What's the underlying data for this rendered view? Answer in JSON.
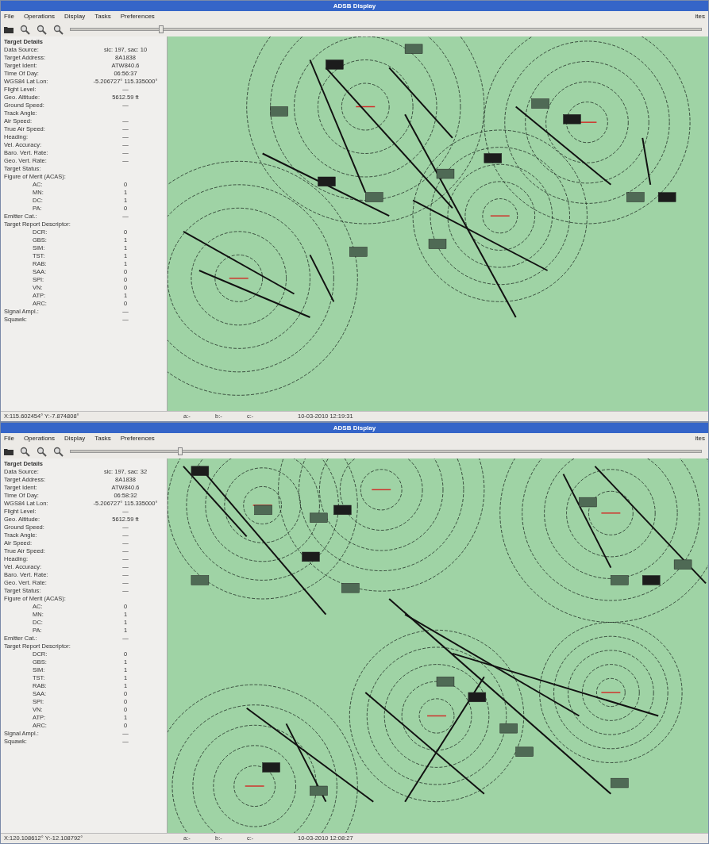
{
  "windows": [
    {
      "title": "ADSB Display",
      "menu": [
        "File",
        "Operations",
        "Display",
        "Tasks",
        "Preferences"
      ],
      "corner_label": "ites",
      "zoom_slider": {
        "level": 0.14
      },
      "panel_title": "Target Details",
      "rows": [
        {
          "kind": "field",
          "label": "Data Source:",
          "value": "sic: 197, sac: 10"
        },
        {
          "kind": "field",
          "label": "Target Address:",
          "value": "8A1838"
        },
        {
          "kind": "field",
          "label": "Target Ident:",
          "value": "ATW840.6"
        },
        {
          "kind": "field",
          "label": "Time Of Day:",
          "value": "06:56:37"
        },
        {
          "kind": "field",
          "label": "WGS84 Lat Lon:",
          "value": "-5.206727° 115.335000°"
        },
        {
          "kind": "field",
          "label": "Flight Level:",
          "value": "—"
        },
        {
          "kind": "field",
          "label": "Geo. Altitude:",
          "value": "5612.59 ft"
        },
        {
          "kind": "field",
          "label": "Ground Speed:",
          "value": "—"
        },
        {
          "kind": "field",
          "label": "Track Angle:",
          "value": ""
        },
        {
          "kind": "field",
          "label": "Air Speed:",
          "value": "—"
        },
        {
          "kind": "field",
          "label": "True Air Speed:",
          "value": "—"
        },
        {
          "kind": "field",
          "label": "Heading:",
          "value": "—"
        },
        {
          "kind": "field",
          "label": "Vel. Accuracy:",
          "value": "—"
        },
        {
          "kind": "field",
          "label": "Baro. Vert. Rate:",
          "value": "—"
        },
        {
          "kind": "field",
          "label": "Geo. Vert. Rate:",
          "value": "—"
        },
        {
          "kind": "field",
          "label": "Target Status:",
          "value": ""
        },
        {
          "kind": "field",
          "label": "Figure of Merit (ACAS):",
          "value": ""
        },
        {
          "kind": "sub",
          "label": "AC:",
          "value": "0"
        },
        {
          "kind": "sub",
          "label": "MN:",
          "value": "1"
        },
        {
          "kind": "sub",
          "label": "DC:",
          "value": "1"
        },
        {
          "kind": "sub",
          "label": "PA:",
          "value": "0"
        },
        {
          "kind": "field",
          "label": "Emitter Cat.:",
          "value": "—"
        },
        {
          "kind": "field",
          "label": "Target Report Descriptor:",
          "value": ""
        },
        {
          "kind": "sub",
          "label": "DCR:",
          "value": "0"
        },
        {
          "kind": "sub",
          "label": "GBS:",
          "value": "1"
        },
        {
          "kind": "sub",
          "label": "SIM:",
          "value": "1"
        },
        {
          "kind": "sub",
          "label": "TST:",
          "value": "1"
        },
        {
          "kind": "sub",
          "label": "RAB:",
          "value": "1"
        },
        {
          "kind": "sub",
          "label": "SAA:",
          "value": "0"
        },
        {
          "kind": "sub",
          "label": "SPI:",
          "value": "0"
        },
        {
          "kind": "sub",
          "label": "VN:",
          "value": "0"
        },
        {
          "kind": "sub",
          "label": "ATP:",
          "value": "1"
        },
        {
          "kind": "sub",
          "label": "ARC:",
          "value": "0"
        },
        {
          "kind": "field",
          "label": "Signal Ampl.:",
          "value": "—"
        },
        {
          "kind": "field",
          "label": "Squawk:",
          "value": "—"
        }
      ],
      "status": [
        "X:115.602454°  Y:-7.874808°",
        "a:-",
        "b:-",
        "c:-",
        "10-03-2010  12:19:31"
      ]
    },
    {
      "title": "ADSB Display",
      "menu": [
        "File",
        "Operations",
        "Display",
        "Tasks",
        "Preferences"
      ],
      "corner_label": "ites",
      "zoom_slider": {
        "level": 0.17
      },
      "panel_title": "Target Details",
      "rows": [
        {
          "kind": "field",
          "label": "Data Source:",
          "value": "sic: 197, sac: 32"
        },
        {
          "kind": "field",
          "label": "Target Address:",
          "value": "8A1838"
        },
        {
          "kind": "field",
          "label": "Target Ident:",
          "value": "ATW840.6"
        },
        {
          "kind": "field",
          "label": "Time Of Day:",
          "value": "06:58:32"
        },
        {
          "kind": "field",
          "label": "WGS84 Lat Lon:",
          "value": "-5.206727° 115.335000°"
        },
        {
          "kind": "field",
          "label": "Flight Level:",
          "value": "—"
        },
        {
          "kind": "field",
          "label": "Geo. Altitude:",
          "value": "5612.59 ft"
        },
        {
          "kind": "field",
          "label": "Ground Speed:",
          "value": "—"
        },
        {
          "kind": "field",
          "label": "Track Angle:",
          "value": "—"
        },
        {
          "kind": "field",
          "label": "Air Speed:",
          "value": "—"
        },
        {
          "kind": "field",
          "label": "True Air Speed:",
          "value": "—"
        },
        {
          "kind": "field",
          "label": "Heading:",
          "value": "—"
        },
        {
          "kind": "field",
          "label": "Vel. Accuracy:",
          "value": "—"
        },
        {
          "kind": "field",
          "label": "Baro. Vert. Rate:",
          "value": "—"
        },
        {
          "kind": "field",
          "label": "Geo. Vert. Rate:",
          "value": "—"
        },
        {
          "kind": "field",
          "label": "Target Status:",
          "value": "—"
        },
        {
          "kind": "field",
          "label": "Figure of Merit (ACAS):",
          "value": ""
        },
        {
          "kind": "sub",
          "label": "AC:",
          "value": "0"
        },
        {
          "kind": "sub",
          "label": "MN:",
          "value": "1"
        },
        {
          "kind": "sub",
          "label": "DC:",
          "value": "1"
        },
        {
          "kind": "sub",
          "label": "PA:",
          "value": "1"
        },
        {
          "kind": "field",
          "label": "Emitter Cat.:",
          "value": "—"
        },
        {
          "kind": "field",
          "label": "Target Report Descriptor:",
          "value": ""
        },
        {
          "kind": "sub",
          "label": "DCR:",
          "value": "0"
        },
        {
          "kind": "sub",
          "label": "GBS:",
          "value": "1"
        },
        {
          "kind": "sub",
          "label": "SIM:",
          "value": "1"
        },
        {
          "kind": "sub",
          "label": "TST:",
          "value": "1"
        },
        {
          "kind": "sub",
          "label": "RAB:",
          "value": "1"
        },
        {
          "kind": "sub",
          "label": "SAA:",
          "value": "0"
        },
        {
          "kind": "sub",
          "label": "SPI:",
          "value": "0"
        },
        {
          "kind": "sub",
          "label": "VN:",
          "value": "0"
        },
        {
          "kind": "sub",
          "label": "ATP:",
          "value": "1"
        },
        {
          "kind": "sub",
          "label": "ARC:",
          "value": "0"
        },
        {
          "kind": "field",
          "label": "Signal Ampl.:",
          "value": "—"
        },
        {
          "kind": "field",
          "label": "Squawk:",
          "value": "—"
        }
      ],
      "status": [
        "X:120.108612°  Y:-12.108792°",
        "a:-",
        "b:-",
        "c:-",
        "10-03-2010  12:08:27"
      ]
    }
  ]
}
